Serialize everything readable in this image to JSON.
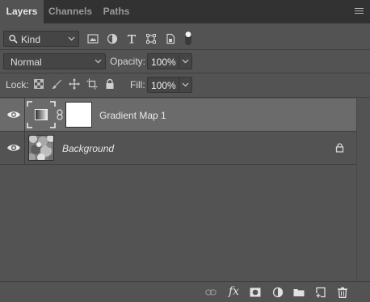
{
  "tabs": [
    {
      "label": "Layers",
      "active": true
    },
    {
      "label": "Channels",
      "active": false
    },
    {
      "label": "Paths",
      "active": false
    }
  ],
  "filter": {
    "kind_label": "Kind",
    "icons": [
      "image-filter-icon",
      "adjustment-filter-icon",
      "type-filter-icon",
      "shape-filter-icon",
      "smart-object-filter-icon",
      "filter-toggle-icon"
    ]
  },
  "blend": {
    "mode": "Normal",
    "opacity_label": "Opacity:",
    "opacity_value": "100%"
  },
  "lock": {
    "label": "Lock:",
    "icons": [
      "lock-transparent-pixels-icon",
      "lock-image-pixels-icon",
      "lock-position-icon",
      "lock-artboard-icon",
      "lock-all-icon"
    ],
    "fill_label": "Fill:",
    "fill_value": "100%"
  },
  "layers": [
    {
      "name": "Gradient Map 1",
      "visible": true,
      "selected": true,
      "italic": false,
      "locked": false
    },
    {
      "name": "Background",
      "visible": true,
      "selected": false,
      "italic": true,
      "locked": true
    }
  ],
  "footer": {
    "icons": [
      "link-layers-icon",
      "fx-icon",
      "add-mask-icon",
      "new-adjustment-layer-icon",
      "new-group-icon",
      "new-layer-icon",
      "delete-layer-icon"
    ]
  },
  "colors": {
    "panel_bg": "#535353",
    "tabbar_bg": "#323232",
    "selected_layer_bg": "#6b6b6b",
    "field_bg": "#454545"
  }
}
